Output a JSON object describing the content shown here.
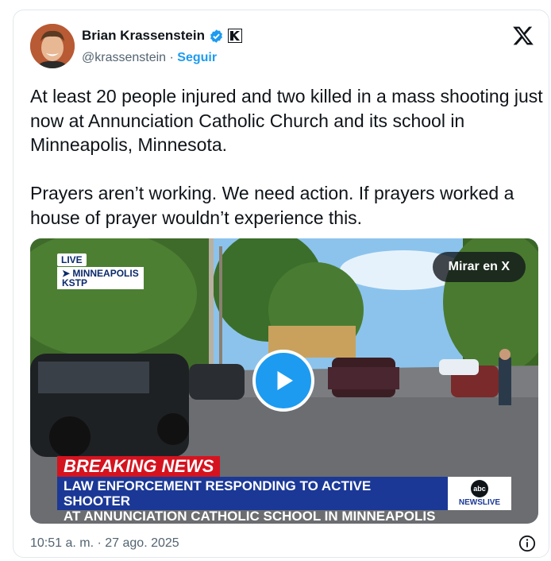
{
  "author": {
    "name": "Brian Krassenstein",
    "handle": "@krassenstein",
    "separator": " · ",
    "follow_label": "Seguir"
  },
  "tweet": {
    "text": "At least 20 people injured and two killed in a mass shooting just now at Annunciation Catholic Church and its school in Minneapolis, Minnesota.\n\nPrayers aren’t working. We need action. If prayers worked a house of prayer wouldn’t experience this."
  },
  "media": {
    "live_label": "LIVE",
    "station_line1": "➤ MINNEAPOLIS",
    "station_line2": "KSTP",
    "watch_label": "Mirar en X",
    "breaking_label": "BREAKING NEWS",
    "headline_line1": "LAW ENFORCEMENT RESPONDING TO ACTIVE SHOOTER",
    "headline_line2": "AT ANNUNCIATION CATHOLIC SCHOOL IN MINNEAPOLIS",
    "network_logo": "abc",
    "network_label": "NEWSLIVE"
  },
  "footer": {
    "timestamp": "10:51 a. m. · 27 ago. 2025"
  },
  "colors": {
    "accent": "#1d9bf0",
    "text": "#0f1419",
    "muted": "#536471",
    "breaking_red": "#d5131f",
    "lower_third_blue": "#1b3896"
  }
}
